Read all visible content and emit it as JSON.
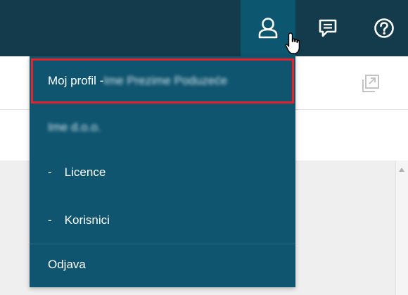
{
  "colors": {
    "topbar": "#133b4c",
    "active_icon_bg": "#0d5670",
    "dropdown_bg": "#0f5570",
    "highlight_border": "#e3252b"
  },
  "topbar": {
    "icons": [
      "user-icon",
      "chat-icon",
      "help-icon"
    ]
  },
  "dropdown": {
    "profile_label": "Moj profil - ",
    "profile_name_redacted": "Ime Prezime Poduzeće",
    "company_redacted": "Ime d.o.o.",
    "items": [
      {
        "dash": "-",
        "label": "Licence"
      },
      {
        "dash": "-",
        "label": "Korisnici"
      }
    ],
    "logout": "Odjava"
  }
}
